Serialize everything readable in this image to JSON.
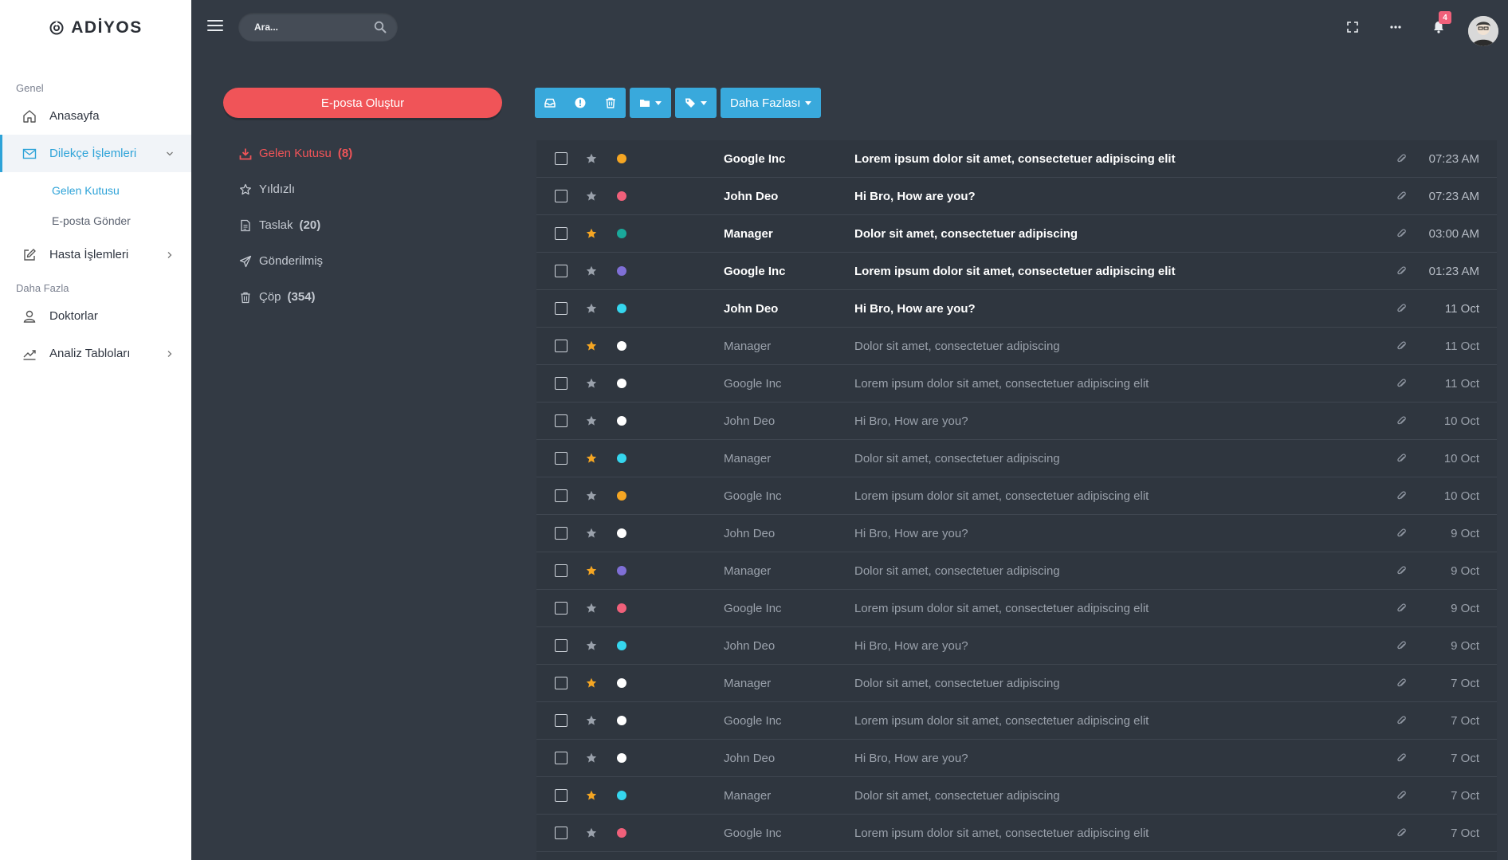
{
  "app": {
    "brand": "ADİYOS"
  },
  "sidebar": {
    "section_general": "Genel",
    "section_more": "Daha Fazla",
    "items": [
      {
        "label": "Anasayfa",
        "icon": "home-icon"
      },
      {
        "label": "Dilekçe İşlemleri",
        "icon": "mail-icon",
        "active": true
      },
      {
        "label": "Hasta İşlemleri",
        "icon": "edit-icon"
      },
      {
        "label": "Doktorlar",
        "icon": "user-icon"
      },
      {
        "label": "Analiz Tabloları",
        "icon": "chart-line-icon"
      }
    ],
    "subitems": [
      {
        "label": "Gelen Kutusu",
        "active": true
      },
      {
        "label": "E-posta Gönder"
      }
    ]
  },
  "topbar": {
    "search_placeholder": "Ara...",
    "notification_count": "4"
  },
  "mail": {
    "compose_label": "E-posta Oluştur",
    "folders": [
      {
        "label": "Gelen Kutusu",
        "count": "(8)",
        "icon": "download-icon",
        "active": true
      },
      {
        "label": "Yıldızlı",
        "count": "",
        "icon": "star-outline-icon"
      },
      {
        "label": "Taslak",
        "count": "(20)",
        "icon": "file-icon"
      },
      {
        "label": "Gönderilmiş",
        "count": "",
        "icon": "send-icon"
      },
      {
        "label": "Çöp",
        "count": "(354)",
        "icon": "trash-icon"
      }
    ],
    "toolbar": {
      "more_label": "Daha Fazlası"
    },
    "colors": {
      "orange": "#f5a623",
      "pink": "#f0607a",
      "teal": "#1aa99b",
      "purple": "#7f6fd6",
      "cyan": "#35d6ee",
      "white": "#ffffff",
      "star_on": "#f5a623",
      "star_off": "#9aa1ab"
    },
    "rows": [
      {
        "sender": "Google Inc",
        "subject": "Lorem ipsum dolor sit amet, consectetuer adipiscing elit",
        "time": "07:23 AM",
        "starred": false,
        "dot": "orange",
        "unread": true
      },
      {
        "sender": "John Deo",
        "subject": "Hi Bro, How are you?",
        "time": "07:23 AM",
        "starred": false,
        "dot": "pink",
        "unread": true
      },
      {
        "sender": "Manager",
        "subject": "Dolor sit amet, consectetuer adipiscing",
        "time": "03:00 AM",
        "starred": true,
        "dot": "teal",
        "unread": true
      },
      {
        "sender": "Google Inc",
        "subject": "Lorem ipsum dolor sit amet, consectetuer adipiscing elit",
        "time": "01:23 AM",
        "starred": false,
        "dot": "purple",
        "unread": true
      },
      {
        "sender": "John Deo",
        "subject": "Hi Bro, How are you?",
        "time": "11 Oct",
        "starred": false,
        "dot": "cyan",
        "unread": true
      },
      {
        "sender": "Manager",
        "subject": "Dolor sit amet, consectetuer adipiscing",
        "time": "11 Oct",
        "starred": true,
        "dot": "white",
        "unread": false
      },
      {
        "sender": "Google Inc",
        "subject": "Lorem ipsum dolor sit amet, consectetuer adipiscing elit",
        "time": "11 Oct",
        "starred": false,
        "dot": "white",
        "unread": false
      },
      {
        "sender": "John Deo",
        "subject": "Hi Bro, How are you?",
        "time": "10 Oct",
        "starred": false,
        "dot": "white",
        "unread": false
      },
      {
        "sender": "Manager",
        "subject": "Dolor sit amet, consectetuer adipiscing",
        "time": "10 Oct",
        "starred": true,
        "dot": "cyan",
        "unread": false
      },
      {
        "sender": "Google Inc",
        "subject": "Lorem ipsum dolor sit amet, consectetuer adipiscing elit",
        "time": "10 Oct",
        "starred": false,
        "dot": "orange",
        "unread": false
      },
      {
        "sender": "John Deo",
        "subject": "Hi Bro, How are you?",
        "time": "9 Oct",
        "starred": false,
        "dot": "white",
        "unread": false
      },
      {
        "sender": "Manager",
        "subject": "Dolor sit amet, consectetuer adipiscing",
        "time": "9 Oct",
        "starred": true,
        "dot": "purple",
        "unread": false
      },
      {
        "sender": "Google Inc",
        "subject": "Lorem ipsum dolor sit amet, consectetuer adipiscing elit",
        "time": "9 Oct",
        "starred": false,
        "dot": "pink",
        "unread": false
      },
      {
        "sender": "John Deo",
        "subject": "Hi Bro, How are you?",
        "time": "9 Oct",
        "starred": false,
        "dot": "cyan",
        "unread": false
      },
      {
        "sender": "Manager",
        "subject": "Dolor sit amet, consectetuer adipiscing",
        "time": "7 Oct",
        "starred": true,
        "dot": "white",
        "unread": false
      },
      {
        "sender": "Google Inc",
        "subject": "Lorem ipsum dolor sit amet, consectetuer adipiscing elit",
        "time": "7 Oct",
        "starred": false,
        "dot": "white",
        "unread": false
      },
      {
        "sender": "John Deo",
        "subject": "Hi Bro, How are you?",
        "time": "7 Oct",
        "starred": false,
        "dot": "white",
        "unread": false
      },
      {
        "sender": "Manager",
        "subject": "Dolor sit amet, consectetuer adipiscing",
        "time": "7 Oct",
        "starred": true,
        "dot": "cyan",
        "unread": false
      },
      {
        "sender": "Google Inc",
        "subject": "Lorem ipsum dolor sit amet, consectetuer adipiscing elit",
        "time": "7 Oct",
        "starred": false,
        "dot": "pink",
        "unread": false
      }
    ]
  }
}
